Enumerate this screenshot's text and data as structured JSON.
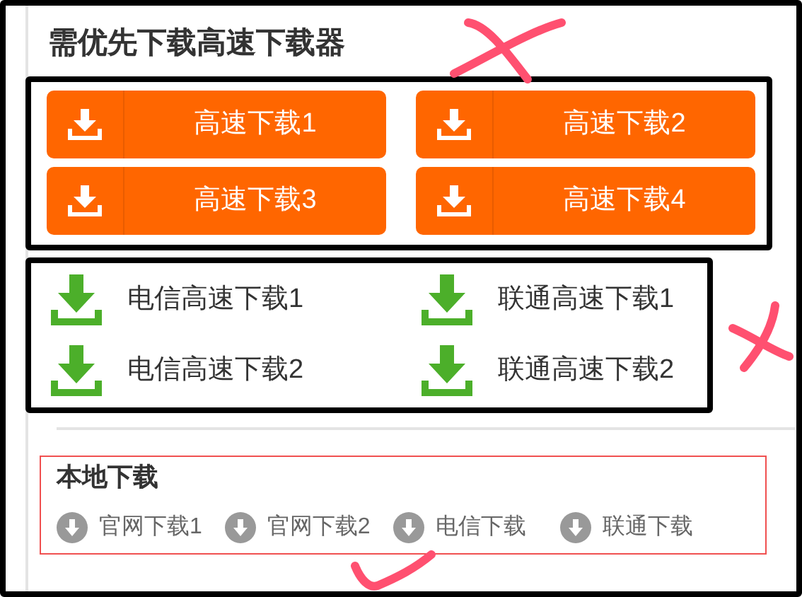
{
  "heading": "需优先下载高速下载器",
  "fast_downloads": [
    {
      "label": "高速下载1"
    },
    {
      "label": "高速下载2"
    },
    {
      "label": "高速下载3"
    },
    {
      "label": "高速下载4"
    }
  ],
  "isp_downloads": [
    {
      "label": "电信高速下载1"
    },
    {
      "label": "联通高速下载1"
    },
    {
      "label": "电信高速下载2"
    },
    {
      "label": "联通高速下载2"
    }
  ],
  "local_download": {
    "title": "本地下载",
    "links": [
      {
        "label": "官网下载1"
      },
      {
        "label": "官网下载2"
      },
      {
        "label": "电信下载"
      },
      {
        "label": "联通下载"
      }
    ]
  },
  "annotations": [
    {
      "kind": "cross"
    },
    {
      "kind": "cross"
    },
    {
      "kind": "check"
    }
  ]
}
